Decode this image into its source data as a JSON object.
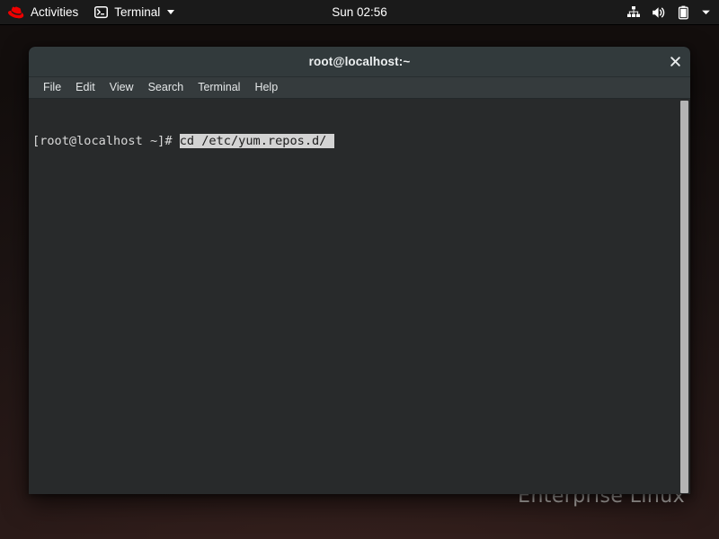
{
  "desktop": {
    "wallpaper_text": "Enterprise Linux",
    "background_color": "#221715"
  },
  "top_bar": {
    "background_color": "#1a1a1a",
    "activities_label": "Activities",
    "activities_icon": "redhat-logo-icon",
    "app_menu": {
      "icon": "terminal-app-icon",
      "label": "Terminal",
      "caret": "chevron-down-icon"
    },
    "clock": "Sun 02:56",
    "status_icons": [
      {
        "name": "network-wired-icon",
        "label": "Network"
      },
      {
        "name": "volume-icon",
        "label": "Volume"
      },
      {
        "name": "battery-icon",
        "label": "Battery"
      },
      {
        "name": "chevron-down-icon",
        "label": "System menu"
      }
    ]
  },
  "terminal_window": {
    "title": "root@localhost:~",
    "title_bar_color": "#323a3c",
    "close_label": "Close",
    "menu": [
      {
        "label": "File"
      },
      {
        "label": "Edit"
      },
      {
        "label": "View"
      },
      {
        "label": "Search"
      },
      {
        "label": "Terminal"
      },
      {
        "label": "Help"
      }
    ],
    "screen": {
      "background_color": "#282a2b",
      "foreground_color": "#d8d8d8",
      "prompt": "[root@localhost ~]# ",
      "command": "cd /etc/yum.repos.d/ ",
      "selection_background": "#d3d3d3",
      "selection_foreground": "#1c1c1c"
    }
  }
}
